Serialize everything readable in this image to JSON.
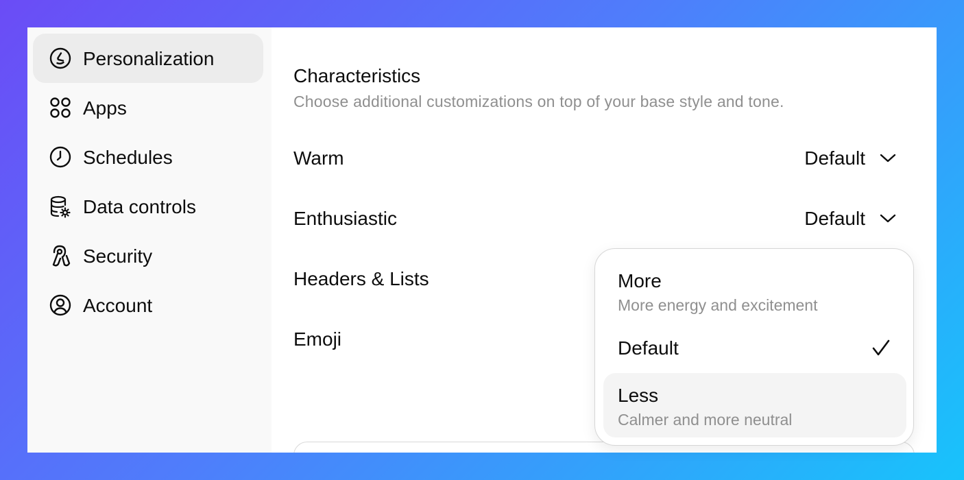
{
  "sidebar": {
    "items": [
      {
        "label": "Personalization",
        "icon": "personalization-icon",
        "active": true
      },
      {
        "label": "Apps",
        "icon": "apps-icon"
      },
      {
        "label": "Schedules",
        "icon": "clock-icon"
      },
      {
        "label": "Data controls",
        "icon": "database-gear-icon"
      },
      {
        "label": "Security",
        "icon": "security-icon"
      },
      {
        "label": "Account",
        "icon": "user-circle-icon"
      }
    ]
  },
  "main": {
    "section_title": "Characteristics",
    "section_description": "Choose additional customizations on top of your base style and tone.",
    "rows": [
      {
        "label": "Warm",
        "value": "Default"
      },
      {
        "label": "Enthusiastic",
        "value": "Default"
      },
      {
        "label": "Headers & Lists"
      },
      {
        "label": "Emoji"
      }
    ]
  },
  "dropdown": {
    "options": [
      {
        "label": "More",
        "description": "More energy and excitement"
      },
      {
        "label": "Default",
        "selected": true
      },
      {
        "label": "Less",
        "description": "Calmer and more neutral",
        "hovered": true
      }
    ]
  },
  "colors": {
    "accent_bg": "#ececec",
    "muted_text": "#8f8f8f",
    "sidebar_bg": "#f9f9f9"
  }
}
